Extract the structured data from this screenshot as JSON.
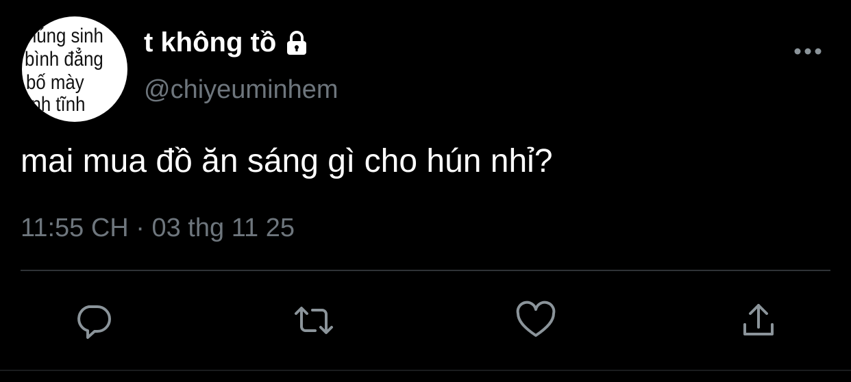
{
  "user": {
    "display_name": "t không tồ",
    "handle": "@chiyeuminhem",
    "avatar_text": [
      "chúng sinh",
      "bình đẳng",
      "bố     mày",
      "bình  tĩnh"
    ],
    "lock_icon": "lock-icon"
  },
  "tweet": {
    "text": "mai mua đồ ăn sáng gì cho hún nhỉ?",
    "timestamp": "11:55 CH · 03 thg 11 25"
  },
  "actions": [
    {
      "name": "reply",
      "icon": "comment-icon"
    },
    {
      "name": "retweet",
      "icon": "retweet-icon"
    },
    {
      "name": "like",
      "icon": "heart-icon"
    },
    {
      "name": "share",
      "icon": "share-icon"
    }
  ],
  "colors": {
    "background": "#000000",
    "text": "#ffffff",
    "secondary_text": "#6e767d",
    "divider": "#2f3336"
  }
}
